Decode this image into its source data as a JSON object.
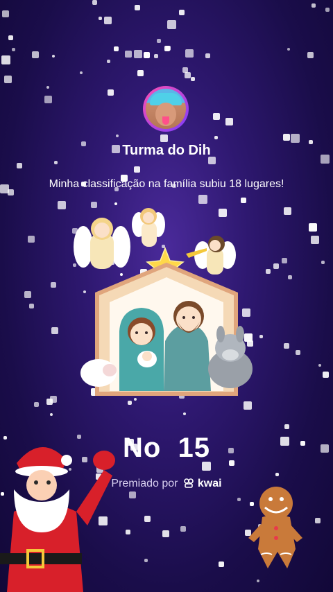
{
  "profile": {
    "name": "Turma do Dih"
  },
  "message": {
    "text": "Minha classificação na família subiu 18 lugares!"
  },
  "rank": {
    "prefix": "No",
    "value": "15"
  },
  "footer": {
    "powered_by": "Premiado por",
    "brand": "kwai"
  },
  "colors": {
    "background": "#2e1870",
    "accent": "#7b3cff"
  }
}
